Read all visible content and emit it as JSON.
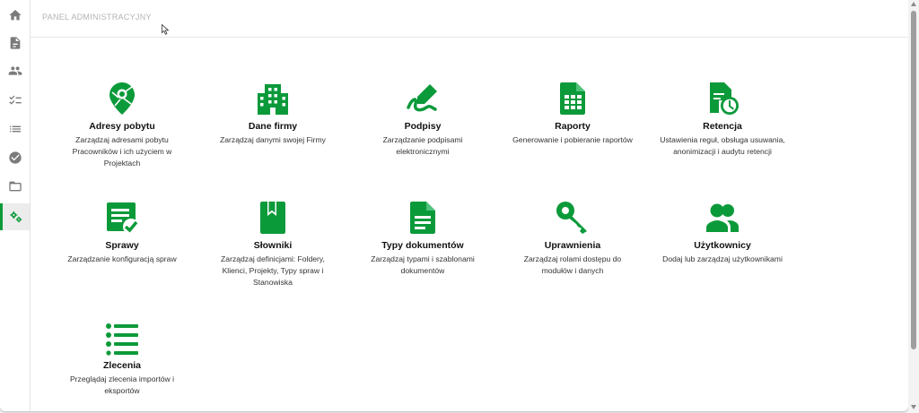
{
  "header": {
    "title": "PANEL ADMINISTRACYJNY"
  },
  "accent_color": "#0b9a3a",
  "sidebar": {
    "items": [
      {
        "icon": "home-icon"
      },
      {
        "icon": "document-icon"
      },
      {
        "icon": "people-icon"
      },
      {
        "icon": "checklist-icon"
      },
      {
        "icon": "list-icon"
      },
      {
        "icon": "check-circle-icon"
      },
      {
        "icon": "folder-open-icon"
      },
      {
        "icon": "settings-gears-icon",
        "active": true
      }
    ]
  },
  "tiles": [
    {
      "title": "Adresy pobytu",
      "desc": "Zarządzaj adresami pobytu Pracowników i ich użyciem w Projektach",
      "icon": "map-pin-icon"
    },
    {
      "title": "Dane firmy",
      "desc": "Zarządzaj danymi swojej Firmy",
      "icon": "building-icon"
    },
    {
      "title": "Podpisy",
      "desc": "Zarządzanie podpisami elektronicznymi",
      "icon": "signature-icon"
    },
    {
      "title": "Raporty",
      "desc": "Generowanie i pobieranie raportów",
      "icon": "spreadsheet-icon"
    },
    {
      "title": "Retencja",
      "desc": "Ustawienia reguł, obsługa usuwania, anonimizacji i audytu retencji",
      "icon": "document-clock-icon"
    },
    {
      "title": "Sprawy",
      "desc": "Zarządzanie konfiguracją spraw",
      "icon": "case-check-icon"
    },
    {
      "title": "Słowniki",
      "desc": "Zarządzaj definicjami: Foldery, Klienci, Projekty, Typy spraw i Stanowiska",
      "icon": "bookmark-book-icon"
    },
    {
      "title": "Typy dokumentów",
      "desc": "Zarządzaj typami i szablonami dokumentów",
      "icon": "document-text-icon"
    },
    {
      "title": "Uprawnienia",
      "desc": "Zarządzaj rolami dostępu do modułów i danych",
      "icon": "key-icon"
    },
    {
      "title": "Użytkownicy",
      "desc": "Dodaj lub zarządzaj użytkownikami",
      "icon": "users-icon"
    },
    {
      "title": "Zlecenia",
      "desc": "Przeglądaj zlecenia importów i eksportów",
      "icon": "bullet-list-icon"
    }
  ]
}
